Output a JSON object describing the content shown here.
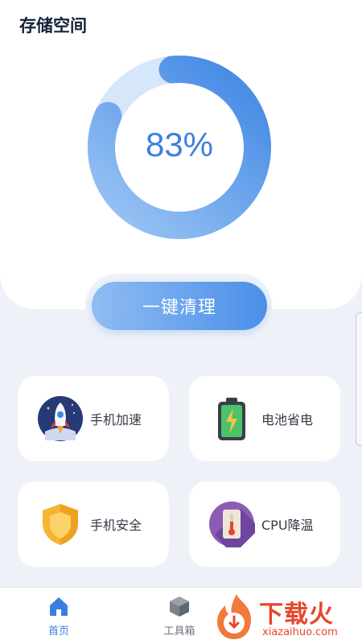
{
  "header": {
    "title": "存储空间"
  },
  "storage": {
    "percent_text": "83%",
    "used_fraction": 0.83
  },
  "clean_button": {
    "label": "一键清理"
  },
  "tiles": [
    {
      "label": "手机加速",
      "icon": "rocket-icon"
    },
    {
      "label": "电池省电",
      "icon": "battery-icon"
    },
    {
      "label": "手机安全",
      "icon": "shield-icon"
    },
    {
      "label": "CPU降温",
      "icon": "thermometer-icon"
    }
  ],
  "bottom_nav": [
    {
      "label": "首页",
      "icon": "home-icon",
      "active": true
    },
    {
      "label": "工具箱",
      "icon": "toolbox-icon",
      "active": false
    }
  ],
  "watermark": {
    "title": "下载火",
    "domain": "xiazaihuo.com"
  },
  "colors": {
    "accent": "#3d7fe0",
    "gauge_track": "#d6e6fb",
    "background": "#eef2f8",
    "watermark": "#e8452a"
  }
}
